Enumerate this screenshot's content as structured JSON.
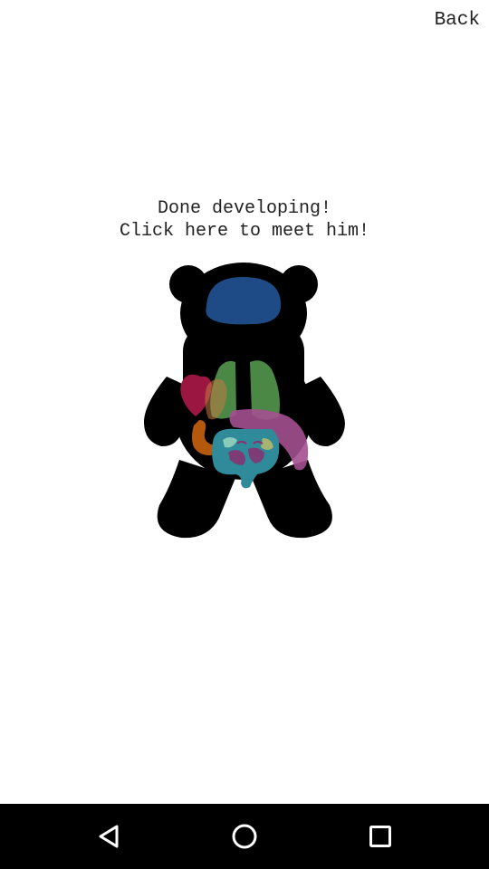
{
  "header": {
    "back_label": "Back"
  },
  "main": {
    "message_line1": "Done developing!",
    "message_line2": "Click here to meet him!"
  },
  "bear": {
    "body_color": "#000000",
    "organ_colors": {
      "brain": "#1e4b86",
      "lungs": "#4f8f4a",
      "heart": "#9b1742",
      "liver": "#a4508f",
      "kidney": "#b4580e",
      "intestines": "#2f8a99",
      "stomach": "#8a2e6e"
    }
  },
  "navbar": {
    "back_icon": "triangle-back-icon",
    "home_icon": "circle-home-icon",
    "recents_icon": "square-recents-icon",
    "icon_color": "#ffffff"
  }
}
